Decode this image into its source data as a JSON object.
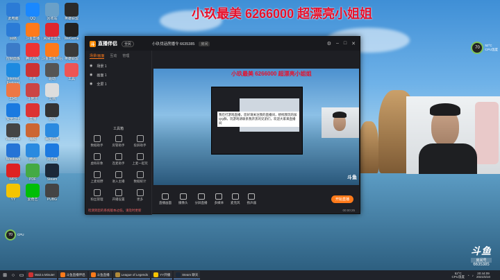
{
  "overlay_title": "小玖最美 6266000 超漂亮小姐姐",
  "desktop_icons": [
    {
      "label": "此电脑",
      "color": "#2b7bd6"
    },
    {
      "label": "QQ",
      "color": "#1a88ff"
    },
    {
      "label": "回收站",
      "color": "#6aa0c8"
    },
    {
      "label": "英雄联盟",
      "color": "#2a2a2a"
    },
    {
      "label": "网络",
      "color": "#2b7bd6"
    },
    {
      "label": "斗鱼直播",
      "color": "#ff7a1a"
    },
    {
      "label": "网易云音乐",
      "color": "#e0262d"
    },
    {
      "label": "WeGame",
      "color": "#222"
    },
    {
      "label": "控制面板",
      "color": "#3b7bc8"
    },
    {
      "label": "腾讯视频",
      "color": "#e33"
    },
    {
      "label": "斗鱼直播伴侣",
      "color": "#ff7a1a"
    },
    {
      "label": "英雄联盟",
      "color": "#3a3a3a"
    },
    {
      "label": "Internet Explorer",
      "color": "#1d8ae0"
    },
    {
      "label": "扑克",
      "color": "#c33"
    },
    {
      "label": "驱动",
      "color": "#555"
    },
    {
      "label": "工具",
      "color": "#e55"
    },
    {
      "label": "2345",
      "color": "#e74"
    },
    {
      "label": "斗地主",
      "color": "#c44"
    },
    {
      "label": "文档",
      "color": "#ddd"
    },
    {
      "label": "安全卫士",
      "color": "#1a7ae0"
    },
    {
      "label": "直播",
      "color": "#d33"
    },
    {
      "label": "游戏",
      "color": "#333"
    },
    {
      "label": "WeGame",
      "color": "#444"
    },
    {
      "label": "海贼",
      "color": "#c63"
    },
    {
      "label": "百度网盘",
      "color": "#2a8ae0"
    },
    {
      "label": "Windows",
      "color": "#2574d6"
    },
    {
      "label": "腾讯",
      "color": "#2a8ae0"
    },
    {
      "label": "浏览器",
      "color": "#1d7ae0"
    },
    {
      "label": "WPS",
      "color": "#d22"
    },
    {
      "label": "PDF",
      "color": "#4a4"
    },
    {
      "label": "Steam",
      "color": "#1b2838"
    },
    {
      "label": "YY",
      "color": "#f5c400"
    },
    {
      "label": "爱奇艺",
      "color": "#00be06"
    },
    {
      "label": "PUBG",
      "color": "#444"
    }
  ],
  "app": {
    "logo_text": "直播伴侣",
    "version_pill": "全民",
    "room_text": "小玖伐话房播令 6635385",
    "room_tag": "房间",
    "tabs": [
      "场景/画面",
      "互动",
      "管理"
    ],
    "scenes": [
      "场景 1",
      "画面 1",
      "全屏 1"
    ],
    "tools_title": "工具箱",
    "tools": [
      "数据助手",
      "房管助手",
      "投屏助手",
      "虚拟形象",
      "连麦助手",
      "上麦一起玩",
      "上麦视野",
      "进入主播",
      "数据统计",
      "粉丝管理",
      "开播设置",
      "更多"
    ],
    "warning": "检测到您的系统版本过低，请及时更新",
    "inner_title": "小玖最美 6266000 超漂亮小姐姐",
    "chat_message": "我在打游戏直播，您好请关注我的直播间，想找我玩的加QQ群，玩游戏请联系我开黑的兄弟们，欢迎大家来直播间",
    "controls": [
      "直播画面",
      "摄像头",
      "分屏直播",
      "多媒体",
      "麦克风",
      "扬声器"
    ],
    "live_button": "开始直播",
    "stats": "00:00:25"
  },
  "cpu_widget": {
    "value": "70",
    "line1": "52°C",
    "line2": "CPU温度"
  },
  "cpu_widget2": {
    "value": "70",
    "line1": "CPU"
  },
  "watermark": {
    "logo": "斗鱼",
    "tag": "房间号",
    "room_id": "6635385"
  },
  "taskbar": {
    "items": [
      {
        "label": "Wait a Minute!",
        "color": "#c33"
      },
      {
        "label": "斗鱼直播伴侣",
        "color": "#ff7a1a"
      },
      {
        "label": "斗鱼直播",
        "color": "#ff7a1a"
      },
      {
        "label": "League of Legends",
        "color": "#b08a3a"
      },
      {
        "label": "YY开播",
        "color": "#f5c400"
      },
      {
        "label": "Steam 聊天",
        "color": "#1b2838"
      }
    ],
    "tray_temp": "52°C",
    "tray_temp_label": "CPU温度",
    "time": "20:44:09",
    "date": "2021/5/10"
  }
}
